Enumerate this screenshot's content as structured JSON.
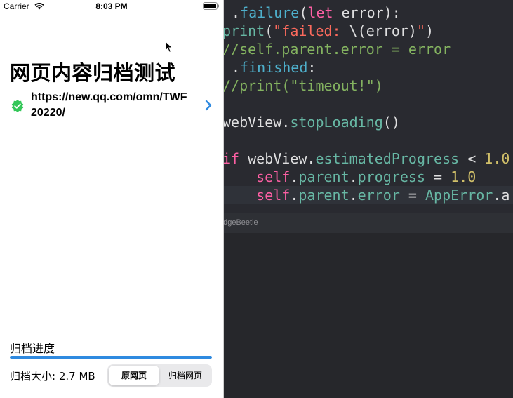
{
  "editor": {
    "code_lines": [
      [
        {
          "t": ".",
          "c": "tk-plain"
        },
        {
          "t": "failure",
          "c": "tk-prop"
        },
        {
          "t": "(",
          "c": "tk-plain"
        },
        {
          "t": "let",
          "c": "tk-kw"
        },
        {
          "t": " error):",
          "c": "tk-plain"
        }
      ],
      [
        {
          "t": "print",
          "c": "tk-fn"
        },
        {
          "t": "(",
          "c": "tk-plain"
        },
        {
          "t": "\"failed: ",
          "c": "tk-str"
        },
        {
          "t": "\\(error)",
          "c": "tk-plain"
        },
        {
          "t": "\"",
          "c": "tk-str"
        },
        {
          "t": ")",
          "c": "tk-plain"
        }
      ],
      [
        {
          "t": "//self.parent.error = error",
          "c": "tk-cmt2"
        }
      ],
      [
        {
          "t": ".",
          "c": "tk-plain"
        },
        {
          "t": "finished",
          "c": "tk-prop"
        },
        {
          "t": ":",
          "c": "tk-plain"
        }
      ],
      [
        {
          "t": "//print(\"timeout!\")",
          "c": "tk-cmt2"
        }
      ],
      [],
      [
        {
          "t": "webView.",
          "c": "tk-plain"
        },
        {
          "t": "stopLoading",
          "c": "tk-fn"
        },
        {
          "t": "()",
          "c": "tk-plain"
        }
      ],
      [],
      [
        {
          "t": "if",
          "c": "tk-kw"
        },
        {
          "t": " webView.",
          "c": "tk-plain"
        },
        {
          "t": "estimatedProgress",
          "c": "tk-fn"
        },
        {
          "t": " < ",
          "c": "tk-plain"
        },
        {
          "t": "1.0",
          "c": "tk-num"
        }
      ],
      [
        {
          "t": "    self",
          "c": "tk-kw"
        },
        {
          "t": ".",
          "c": "tk-plain"
        },
        {
          "t": "parent",
          "c": "tk-fn"
        },
        {
          "t": ".",
          "c": "tk-plain"
        },
        {
          "t": "progress",
          "c": "tk-fn"
        },
        {
          "t": " = ",
          "c": "tk-plain"
        },
        {
          "t": "1.0",
          "c": "tk-num"
        }
      ],
      [
        {
          "t": "    self",
          "c": "tk-kw"
        },
        {
          "t": ".",
          "c": "tk-plain"
        },
        {
          "t": "parent",
          "c": "tk-fn"
        },
        {
          "t": ".",
          "c": "tk-plain"
        },
        {
          "t": "error",
          "c": "tk-fn"
        },
        {
          "t": " = ",
          "c": "tk-plain"
        },
        {
          "t": "AppError",
          "c": "tk-fn"
        },
        {
          "t": ".a",
          "c": "tk-plain"
        }
      ]
    ],
    "debug_label": "edgeBeetle"
  },
  "status_bar": {
    "carrier": "Carrier",
    "time": "8:03 PM"
  },
  "app": {
    "title": "网页内容归档测试",
    "url": "https://new.qq.com/omn/TWF20220/",
    "progress_label": "归档进度",
    "progress": 1.0,
    "size_label": "归档大小: 2.7 MB",
    "segments": [
      "原网页",
      "归档网页"
    ],
    "selected_segment": 0,
    "accent_color": "#2f8ae0",
    "verified_color": "#34c759"
  }
}
